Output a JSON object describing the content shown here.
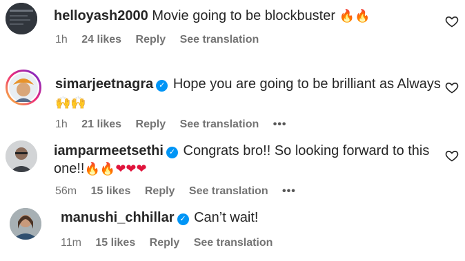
{
  "comments": [
    {
      "username": "helloyash2000",
      "verified": false,
      "text": "Movie going to be blockbuster",
      "emojis": "🔥🔥",
      "time": "1h",
      "likes": "24 likes",
      "reply": "Reply",
      "see_translation": "See translation",
      "more": ""
    },
    {
      "username": "simarjeetnagra",
      "verified": true,
      "text": "Hope you are going to be brilliant as Always",
      "text_line2": "",
      "emojis": "🙌🙌",
      "time": "1h",
      "likes": "21 likes",
      "reply": "Reply",
      "see_translation": "See translation",
      "more": "•••"
    },
    {
      "username": "iamparmeetsethi",
      "verified": true,
      "text": "Congrats bro!! So looking forward to this",
      "text_line2": "one!!",
      "emojis_fire": "🔥🔥",
      "emojis_hearts": "❤❤❤",
      "time": "56m",
      "likes": "15 likes",
      "reply": "Reply",
      "see_translation": "See translation",
      "more": "•••"
    },
    {
      "username": "manushi_chhillar",
      "verified": true,
      "text": "Can’t wait!",
      "time": "11m",
      "likes": "15 likes",
      "reply": "Reply",
      "see_translation": "See translation",
      "more": ""
    }
  ],
  "colors": {
    "verified_blue": "#0095f6",
    "meta_gray": "#737373"
  },
  "icons": {
    "like": "heart-outline-icon",
    "verified": "verified-badge-icon",
    "more": "more-options-icon"
  }
}
